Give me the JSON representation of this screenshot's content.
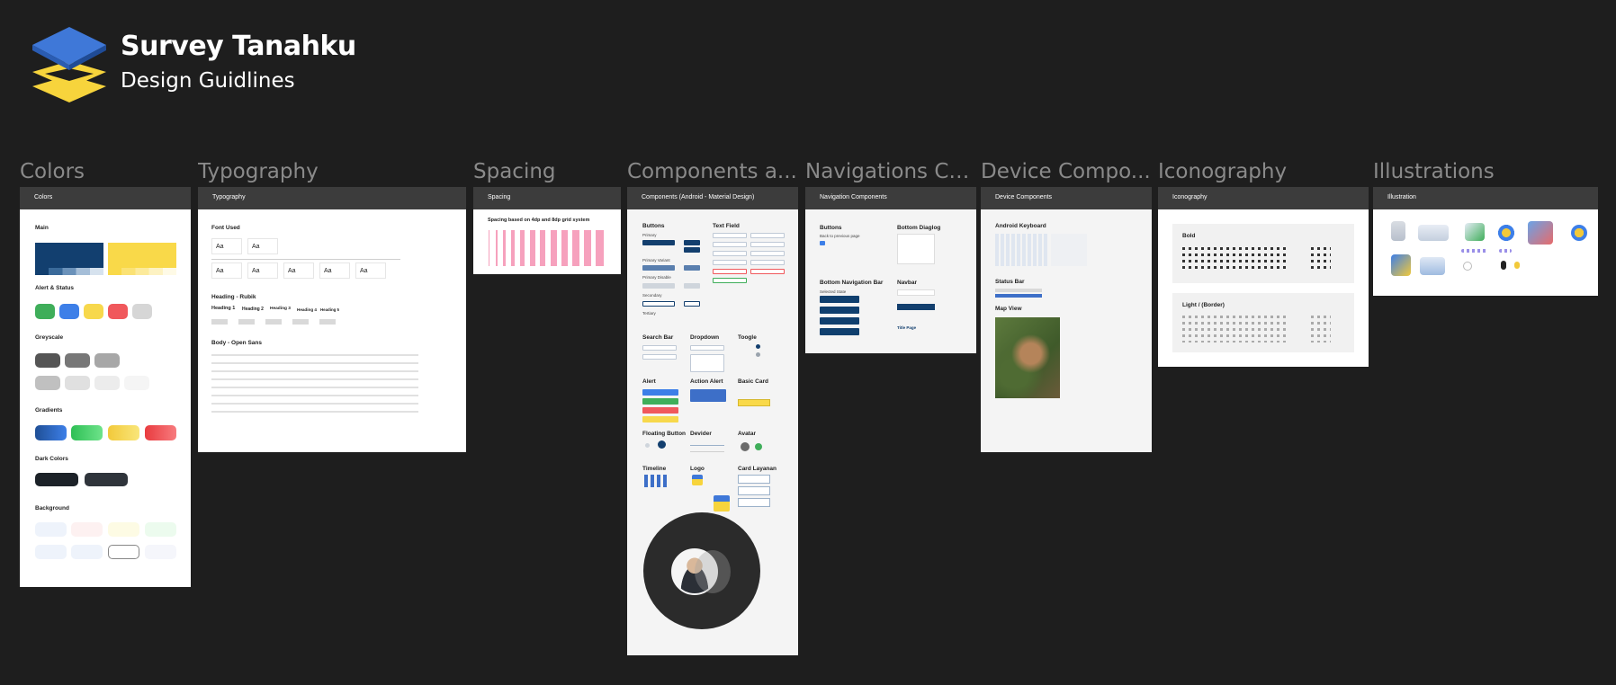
{
  "brand": {
    "title": "Survey Tanahku",
    "subtitle": "Design Guidlines",
    "logo_icon": "stacked-layers-logo",
    "colors": {
      "top_layer": "#3f78d8",
      "lower_layers": "#f7d43c",
      "background": "#1e1e1e"
    }
  },
  "sections": [
    {
      "title": "Colors",
      "frame_label": "Colors"
    },
    {
      "title": "Typography",
      "frame_label": "Typography"
    },
    {
      "title": "Spacing",
      "frame_label": "Spacing"
    },
    {
      "title": "Components a...",
      "frame_label": "Components (Android - Material Design)"
    },
    {
      "title": "Navigations Co...",
      "frame_label": "Navigation Components"
    },
    {
      "title": "Device Compo...",
      "frame_label": "Device Components"
    },
    {
      "title": "Iconography",
      "frame_label": "Iconography"
    },
    {
      "title": "Illustrations",
      "frame_label": "Illustration"
    }
  ],
  "colors_frame": {
    "groups": [
      "Main",
      "Alert & Status",
      "Greyscale",
      "Gradients",
      "Dark Colors",
      "Background"
    ],
    "main": [
      "#123f6f",
      "#f9d949"
    ],
    "alert": [
      "#3fae5a",
      "#3d7fe8",
      "#f7d84c",
      "#f0585c",
      "#d6d6d6"
    ],
    "grey_dark": [
      "#555555",
      "#777777",
      "#a7a7a7"
    ],
    "grey_light": [
      "#c0c0c0",
      "#e0e0e0",
      "#ececec",
      "#f5f5f5"
    ],
    "gradients": [
      "#1f5fb0",
      "#3fcf63",
      "#f7d84c",
      "#f0484c"
    ],
    "dark": [
      "#1c2228",
      "#2f343b"
    ],
    "background": [
      "#eef3fb",
      "#fdf1f1",
      "#fdfbe4",
      "#ecfbee",
      "#eef3fb",
      "#eef3fb",
      "#ffffff",
      "#f5f6fb"
    ]
  },
  "typography_frame": {
    "font_used": "Font Used",
    "aa": [
      "Aa",
      "Aa",
      "Aa",
      "Aa",
      "Aa",
      "Aa",
      "Aa",
      "Aa"
    ],
    "heading_group": "Heading - Rubik",
    "headings": [
      "Heading 1",
      "Heading 2",
      "Heading 3",
      "Heading 4",
      "Heading 5"
    ],
    "body_group": "Body - Open Sans"
  },
  "spacing_frame": {
    "subtitle": "Spacing based on 4dp and 8dp grid system",
    "bar_count": 13
  },
  "components_frame": {
    "labels": [
      "Buttons",
      "Text Field",
      "Primary",
      "Primary Variant",
      "Primary Disable",
      "Secondary",
      "Tertiary",
      "Search Bar",
      "Dropdown",
      "Toogle",
      "Alert",
      "Action Alert",
      "Basic Card",
      "Floating Button",
      "Devider",
      "Avatar",
      "Timeline",
      "Logo",
      "Card Layanan"
    ],
    "button_color": "#133f6e",
    "alert_colors": [
      "#3d7fe8",
      "#3fae5a",
      "#f0585c",
      "#f7d84c"
    ]
  },
  "navigation_frame": {
    "labels": [
      "Buttons",
      "Bottom Diaglog",
      "Back to previous page",
      "Bottom Navigation Bar",
      "Navbar",
      "Selected State",
      "Title Page"
    ]
  },
  "device_frame": {
    "labels": [
      "Android Keyboard",
      "Status Bar",
      "Map View"
    ]
  },
  "iconography_frame": {
    "labels": [
      "Bold",
      "Light / (Border)"
    ]
  },
  "presenter": {
    "avatar_icon": "presenter-avatar",
    "ring_color": "#2b2b2b"
  }
}
